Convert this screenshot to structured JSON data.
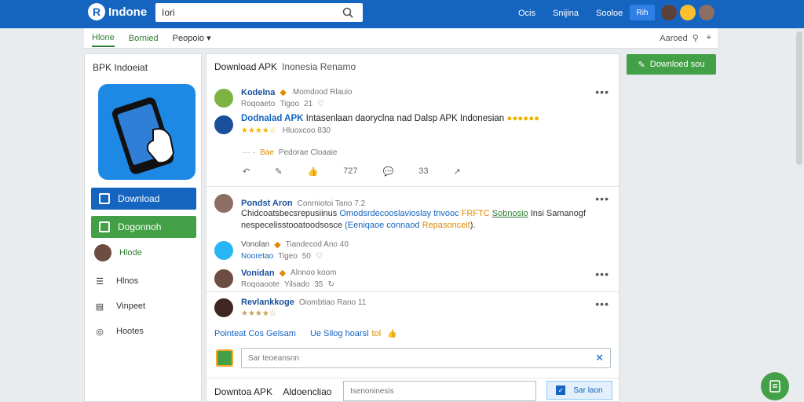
{
  "topbar": {
    "logo_text": "Indone",
    "search_value": "Iori",
    "nav": [
      "Ocis",
      "Snijina",
      "Sooloe"
    ],
    "nav_button": "Rih"
  },
  "subbar": {
    "tabs": [
      "Hlone",
      "Bornied",
      "Peopoio"
    ],
    "right_label": "Aaroed"
  },
  "sidebar": {
    "title": "BPK Indoeiat",
    "download_label": "Download",
    "green_label": "Dogonnoh",
    "items": [
      "Hlode",
      "Hlnos",
      "Vinpeet",
      "Hootes"
    ]
  },
  "main": {
    "header_title": "Download APK",
    "header_sub": "Inonesia  Renamo",
    "post1": {
      "name": "Kodelna",
      "meta1": "Momdood Rlauio",
      "meta2": "Roqoaeto",
      "meta3": "Tigoo",
      "meta4": "21",
      "line1_name": "Dodnalad APK",
      "line1_text": "Intasenlaan daoryclna nad Dalsp APK Indonesian",
      "line1_meta": "Hluoxcoo 830",
      "stars": "★★★★☆",
      "line2_orange": "Bae",
      "line2_text": "Pedorae  Cloaaie",
      "actions": [
        "↶",
        "✎",
        "👍",
        "727",
        "💬",
        "33",
        "↗"
      ]
    },
    "post2": {
      "name": "Pondst Aron",
      "meta1": "Conrniotoi Tano 7.2",
      "text_a": "Chidcoatsbecsrepusiinus",
      "text_b": "Omodsrdecooslavioslay tnvooc",
      "text_c": "FRFTC",
      "text_d": "Sobnosio",
      "text_e": "Insi Samanogf",
      "text_f": "nespecelisstooatoodsosce",
      "text_g": "(Eeniqaoe connaod",
      "text_h": "Repasonceit",
      "text_i": ")."
    },
    "post3": {
      "name": "Vonolan",
      "meta1": "Tiandecod Ano 40",
      "meta2": "Nooretao",
      "meta3": "Tigeo",
      "meta4": "50"
    },
    "post4": {
      "name": "Vonidan",
      "meta1": "Alnnoo koom",
      "meta2": "Roqoaoote",
      "meta3": "Yilsado",
      "meta4": "35"
    },
    "post5": {
      "name": "Revlankkoge",
      "meta1": "Oiombtiao Rano 11",
      "stars": "★★★★☆"
    },
    "links": {
      "link1": "Pointeat Cos Gelsam",
      "link2": "Ue Silog hoarsl",
      "link2_badge": "tol"
    },
    "comment_placeholder": "Sar teoeansnn",
    "bottom": {
      "label_a": "Downtoa APK",
      "label_b": "Aldoencliao",
      "input_placeholder": "Isenoninesis",
      "button_label": "Sar laon"
    }
  },
  "right": {
    "download_label": "Downloed sou"
  },
  "colors": {
    "brand_blue": "#1565c0",
    "brand_green": "#43a047"
  }
}
